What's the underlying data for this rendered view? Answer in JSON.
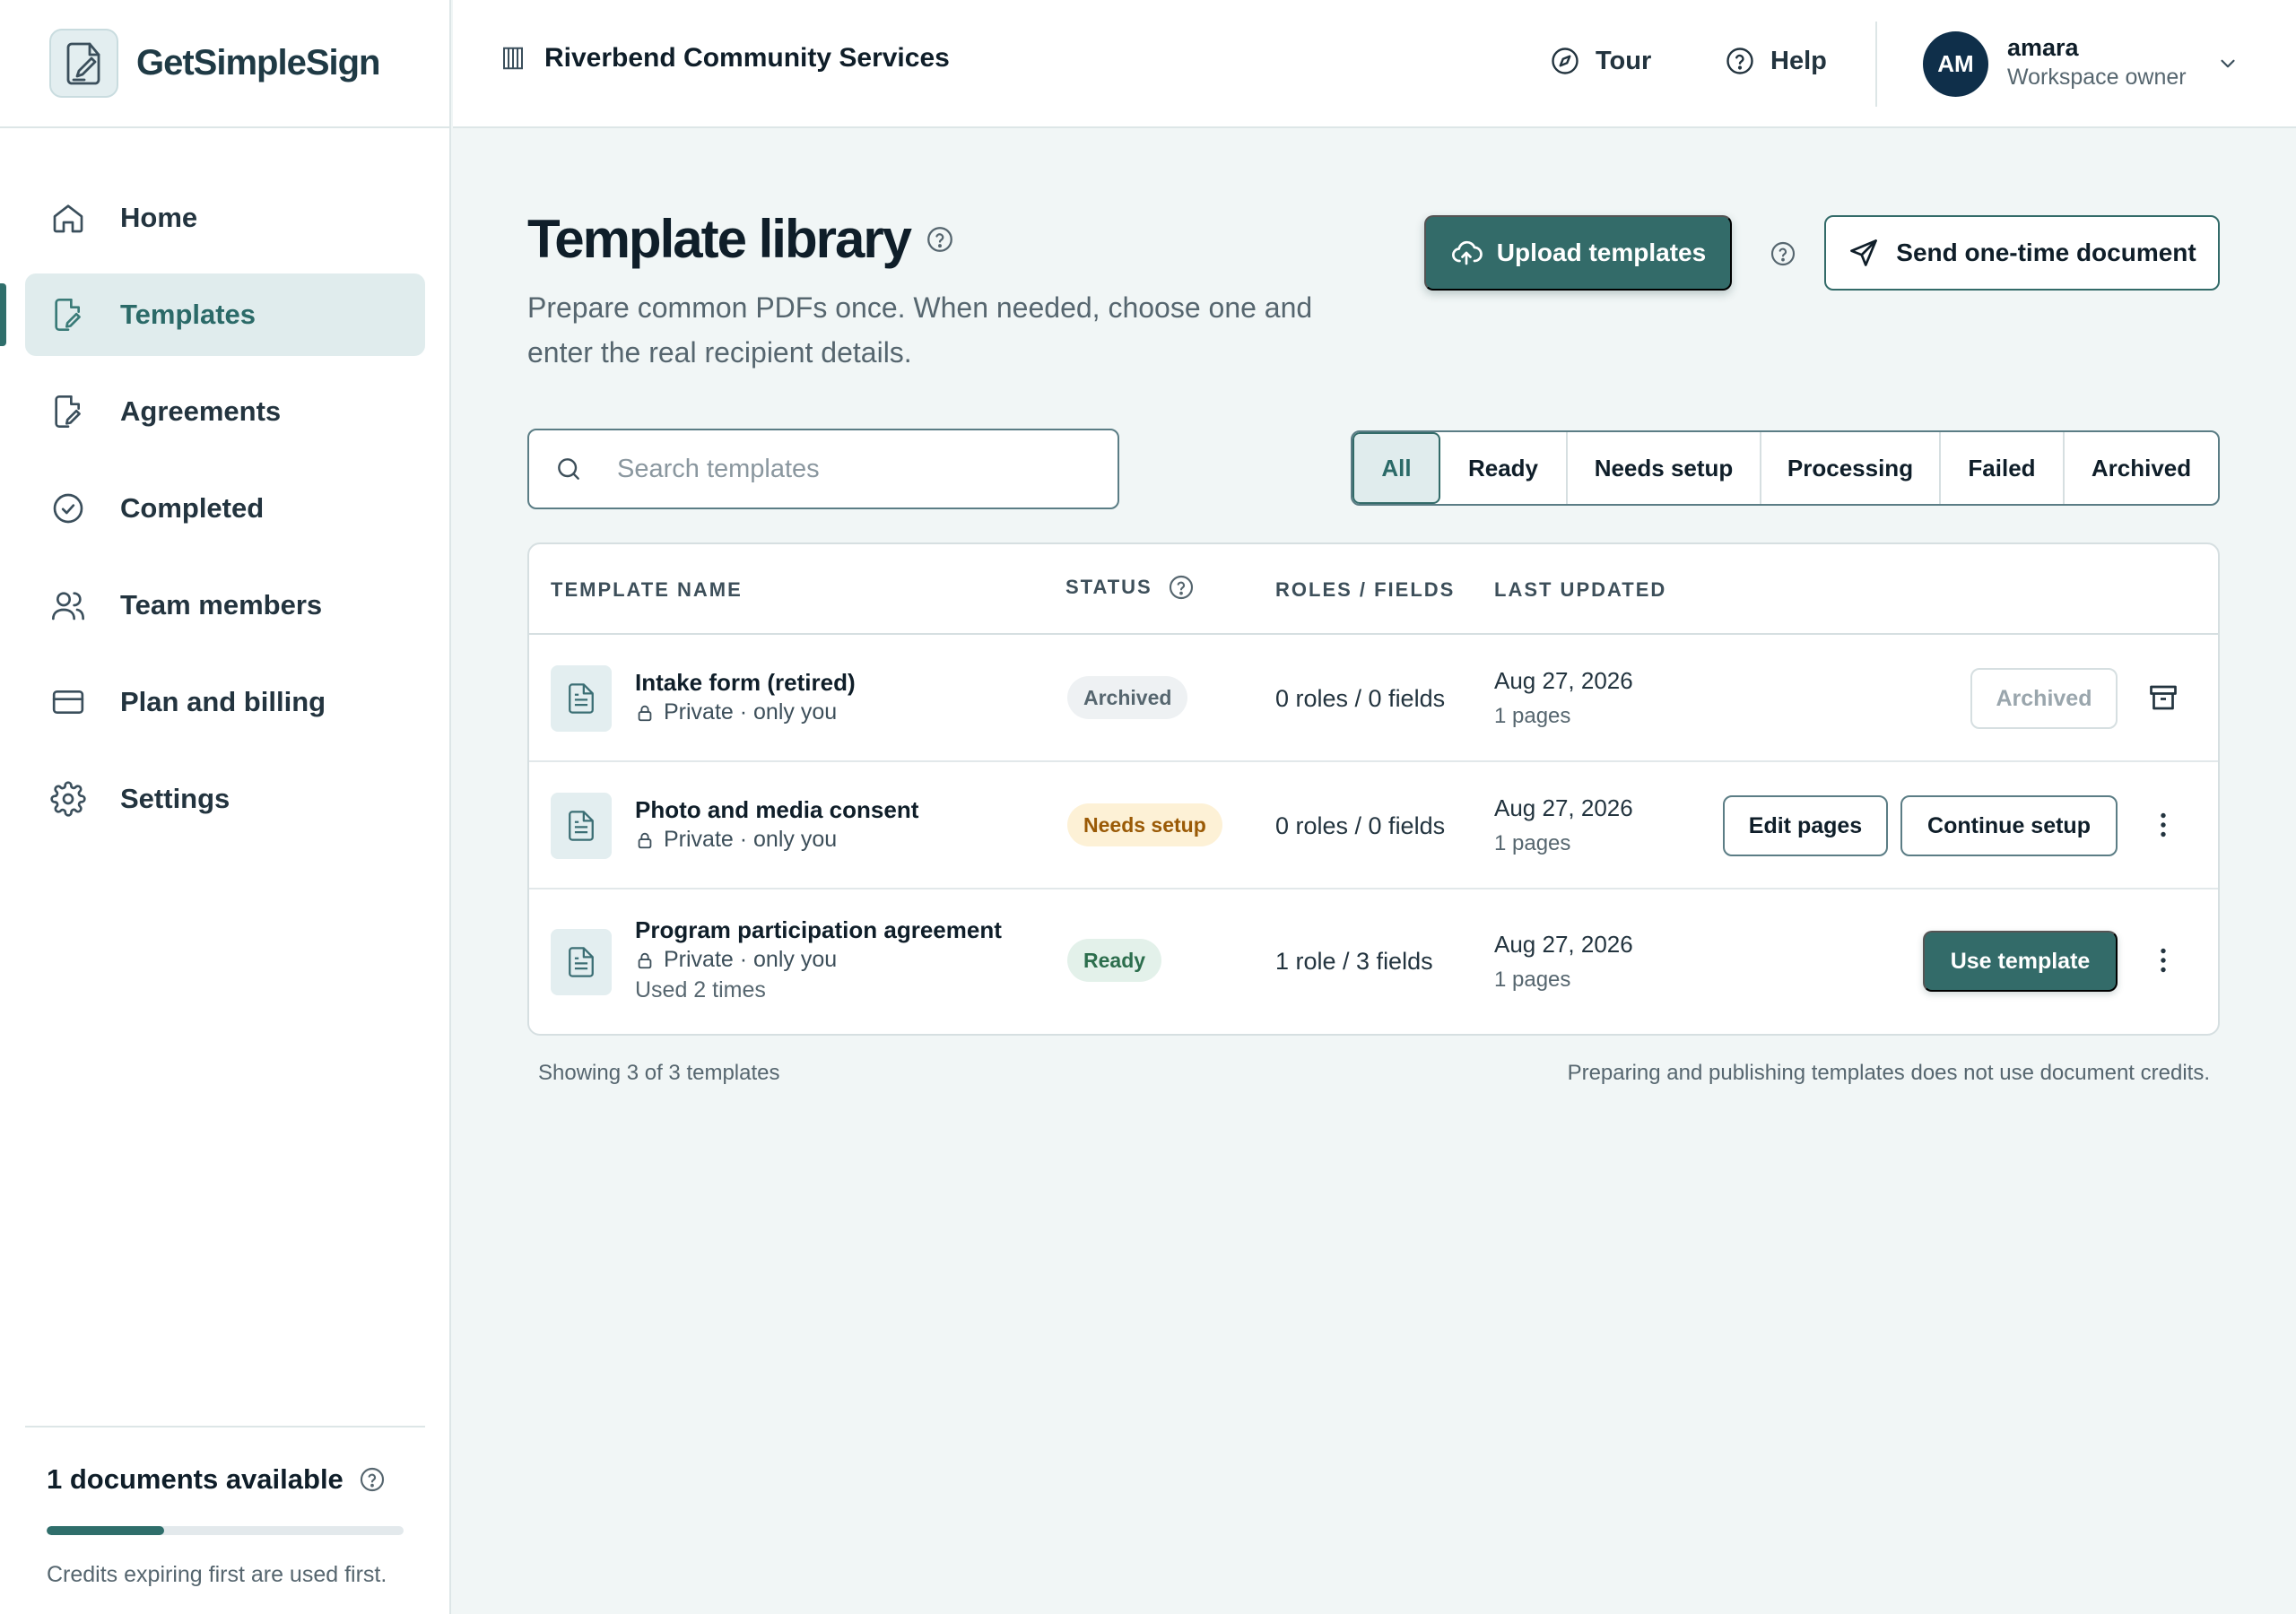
{
  "brand": {
    "name": "GetSimpleSign",
    "logo_icon": "pen-document-icon"
  },
  "sidebar": {
    "items": [
      {
        "label": "Home",
        "icon": "home-icon"
      },
      {
        "label": "Templates",
        "icon": "template-edit-icon",
        "active": true
      },
      {
        "label": "Agreements",
        "icon": "agreement-icon"
      },
      {
        "label": "Completed",
        "icon": "check-circle-icon"
      },
      {
        "label": "Team members",
        "icon": "users-icon"
      },
      {
        "label": "Plan and billing",
        "icon": "credit-card-icon"
      },
      {
        "label": "Settings",
        "icon": "gear-icon"
      }
    ],
    "credits": {
      "title": "1 documents available",
      "progress_fraction": 0.33,
      "note": "Credits expiring first are used first."
    }
  },
  "header": {
    "org_name": "Riverbend Community Services",
    "tour_label": "Tour",
    "help_label": "Help",
    "user": {
      "initials": "AM",
      "name": "amara",
      "role": "Workspace owner"
    }
  },
  "main": {
    "title": "Template library",
    "subtitle": "Prepare common PDFs once. When needed, choose one and enter the real recipient details.",
    "upload_label": "Upload templates",
    "send_label": "Send one-time document",
    "search_placeholder": "Search templates",
    "filters": [
      "All",
      "Ready",
      "Needs setup",
      "Processing",
      "Failed",
      "Archived"
    ],
    "active_filter": "All",
    "columns": {
      "name": "TEMPLATE NAME",
      "status": "STATUS",
      "roles": "ROLES / FIELDS",
      "updated": "LAST UPDATED"
    },
    "rows": [
      {
        "name": "Intake form (retired)",
        "privacy": "Private · only you",
        "usage": "",
        "status": "Archived",
        "roles": "0 roles / 0 fields",
        "date": "Aug 27, 2026",
        "pages": "1 pages",
        "actions": [
          "Archived"
        ],
        "trailing_icon": "archive-icon"
      },
      {
        "name": "Photo and media consent",
        "privacy": "Private · only you",
        "usage": "",
        "status": "Needs setup",
        "roles": "0 roles / 0 fields",
        "date": "Aug 27, 2026",
        "pages": "1 pages",
        "actions": [
          "Edit pages",
          "Continue setup"
        ],
        "trailing_icon": "more-vertical-icon"
      },
      {
        "name": "Program participation agreement",
        "privacy": "Private · only you",
        "usage": "Used 2 times",
        "status": "Ready",
        "roles": "1 role / 3 fields",
        "date": "Aug 27, 2026",
        "pages": "1 pages",
        "actions": [
          "Use template"
        ],
        "trailing_icon": "more-vertical-icon"
      }
    ],
    "footer_count": "Showing 3 of 3 templates",
    "footer_note": "Preparing and publishing templates does not use document credits."
  },
  "colors": {
    "accent": "#336b69",
    "active_bg": "#e0eced",
    "needs_setup": "#9a5a06",
    "ready": "#2c6e4d",
    "avatar_bg": "#0f2f4a"
  }
}
